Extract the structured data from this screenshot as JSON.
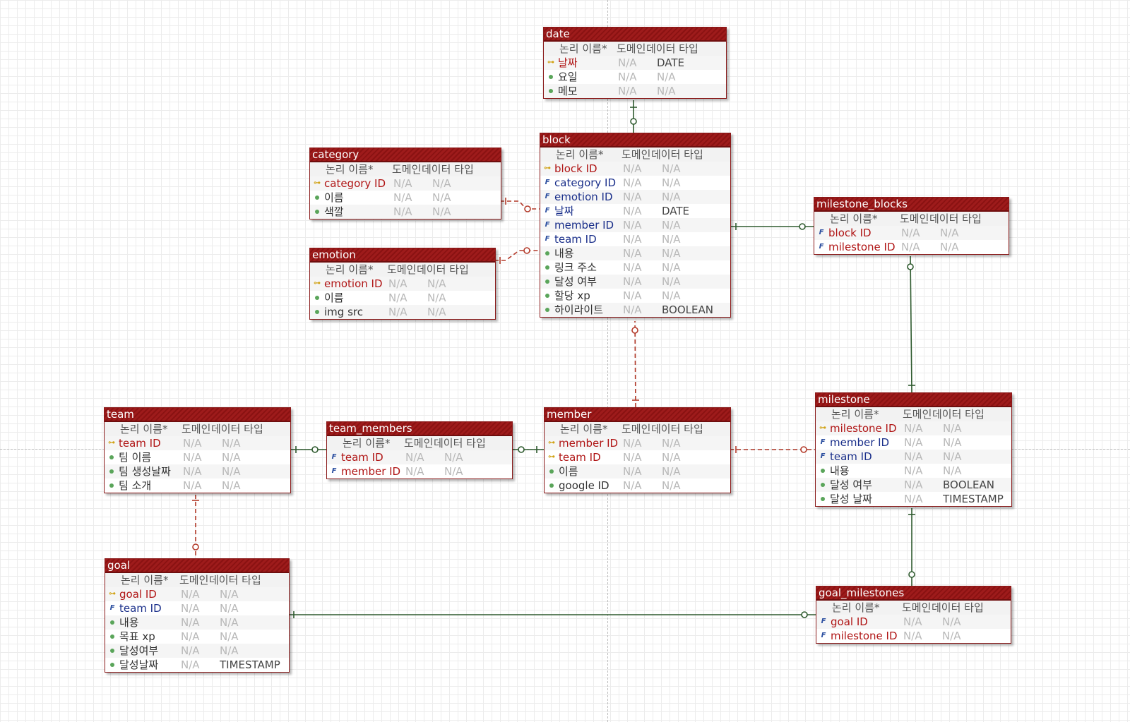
{
  "header_labels": {
    "logical_name": "논리 이름*",
    "domain": "도메인",
    "data_type": "데이터 타입"
  },
  "entities": {
    "date": {
      "name": "date",
      "columns": [
        {
          "name": "날짜",
          "key": "pk",
          "domain": "N/A",
          "type": "DATE"
        },
        {
          "name": "요일",
          "key": "attr",
          "domain": "N/A",
          "type": "N/A"
        },
        {
          "name": "메모",
          "key": "attr",
          "domain": "N/A",
          "type": "N/A"
        }
      ]
    },
    "category": {
      "name": "category",
      "columns": [
        {
          "name": "category ID",
          "key": "pk",
          "domain": "N/A",
          "type": "N/A"
        },
        {
          "name": "이름",
          "key": "attr",
          "domain": "N/A",
          "type": "N/A"
        },
        {
          "name": "색깔",
          "key": "attr",
          "domain": "N/A",
          "type": "N/A"
        }
      ]
    },
    "emotion": {
      "name": "emotion",
      "columns": [
        {
          "name": "emotion ID",
          "key": "pk",
          "domain": "N/A",
          "type": "N/A"
        },
        {
          "name": "이름",
          "key": "attr",
          "domain": "N/A",
          "type": "N/A"
        },
        {
          "name": "img src",
          "key": "attr",
          "domain": "N/A",
          "type": "N/A"
        }
      ]
    },
    "block": {
      "name": "block",
      "columns": [
        {
          "name": "block ID",
          "key": "pk",
          "domain": "N/A",
          "type": "N/A"
        },
        {
          "name": "category ID",
          "key": "fk",
          "domain": "N/A",
          "type": "N/A"
        },
        {
          "name": "emotion ID",
          "key": "fk",
          "domain": "N/A",
          "type": "N/A"
        },
        {
          "name": "날짜",
          "key": "fk",
          "domain": "N/A",
          "type": "DATE"
        },
        {
          "name": "member ID",
          "key": "fk",
          "domain": "N/A",
          "type": "N/A"
        },
        {
          "name": "team ID",
          "key": "fk",
          "domain": "N/A",
          "type": "N/A"
        },
        {
          "name": "내용",
          "key": "attr",
          "domain": "N/A",
          "type": "N/A"
        },
        {
          "name": "링크 주소",
          "key": "attr",
          "domain": "N/A",
          "type": "N/A"
        },
        {
          "name": "달성 여부",
          "key": "attr",
          "domain": "N/A",
          "type": "N/A"
        },
        {
          "name": "할당 xp",
          "key": "attr",
          "domain": "N/A",
          "type": "N/A"
        },
        {
          "name": "하이라이트",
          "key": "attr",
          "domain": "N/A",
          "type": "BOOLEAN"
        }
      ]
    },
    "milestone_blocks": {
      "name": "milestone_blocks",
      "columns": [
        {
          "name": "block ID",
          "key": "pfk",
          "domain": "N/A",
          "type": "N/A"
        },
        {
          "name": "milestone ID",
          "key": "pfk",
          "domain": "N/A",
          "type": "N/A"
        }
      ]
    },
    "team": {
      "name": "team",
      "columns": [
        {
          "name": "team ID",
          "key": "pk",
          "domain": "N/A",
          "type": "N/A"
        },
        {
          "name": "팀 이름",
          "key": "attr",
          "domain": "N/A",
          "type": "N/A"
        },
        {
          "name": "팀 생성날짜",
          "key": "attr",
          "domain": "N/A",
          "type": "N/A"
        },
        {
          "name": "팀 소개",
          "key": "attr",
          "domain": "N/A",
          "type": "N/A"
        }
      ]
    },
    "team_members": {
      "name": "team_members",
      "columns": [
        {
          "name": "team ID",
          "key": "pfk",
          "domain": "N/A",
          "type": "N/A"
        },
        {
          "name": "member ID",
          "key": "pfk",
          "domain": "N/A",
          "type": "N/A"
        }
      ]
    },
    "member": {
      "name": "member",
      "columns": [
        {
          "name": "member ID",
          "key": "pk",
          "domain": "N/A",
          "type": "N/A"
        },
        {
          "name": "team ID",
          "key": "pk",
          "domain": "N/A",
          "type": "N/A"
        },
        {
          "name": "이름",
          "key": "attr",
          "domain": "N/A",
          "type": "N/A"
        },
        {
          "name": "google ID",
          "key": "attr",
          "domain": "N/A",
          "type": "N/A"
        }
      ]
    },
    "milestone": {
      "name": "milestone",
      "columns": [
        {
          "name": "milestone ID",
          "key": "pk",
          "domain": "N/A",
          "type": "N/A"
        },
        {
          "name": "member ID",
          "key": "fk",
          "domain": "N/A",
          "type": "N/A"
        },
        {
          "name": "team ID",
          "key": "fk",
          "domain": "N/A",
          "type": "N/A"
        },
        {
          "name": "내용",
          "key": "attr",
          "domain": "N/A",
          "type": "N/A"
        },
        {
          "name": "달성 여부",
          "key": "attr",
          "domain": "N/A",
          "type": "BOOLEAN"
        },
        {
          "name": "달성 날짜",
          "key": "attr",
          "domain": "N/A",
          "type": "TIMESTAMP"
        }
      ]
    },
    "goal": {
      "name": "goal",
      "columns": [
        {
          "name": "goal ID",
          "key": "pk",
          "domain": "N/A",
          "type": "N/A"
        },
        {
          "name": "team ID",
          "key": "fk",
          "domain": "N/A",
          "type": "N/A"
        },
        {
          "name": "내용",
          "key": "attr",
          "domain": "N/A",
          "type": "N/A"
        },
        {
          "name": "목표 xp",
          "key": "attr",
          "domain": "N/A",
          "type": "N/A"
        },
        {
          "name": "달성여부",
          "key": "attr",
          "domain": "N/A",
          "type": "N/A"
        },
        {
          "name": "달성날짜",
          "key": "attr",
          "domain": "N/A",
          "type": "TIMESTAMP"
        }
      ]
    },
    "goal_milestones": {
      "name": "goal_milestones",
      "columns": [
        {
          "name": "goal ID",
          "key": "pfk",
          "domain": "N/A",
          "type": "N/A"
        },
        {
          "name": "milestone ID",
          "key": "pfk",
          "domain": "N/A",
          "type": "N/A"
        }
      ]
    }
  },
  "relationships": [
    {
      "from": "date",
      "to": "block",
      "style": "identifying"
    },
    {
      "from": "category",
      "to": "block",
      "style": "non-identifying"
    },
    {
      "from": "emotion",
      "to": "block",
      "style": "non-identifying"
    },
    {
      "from": "block",
      "to": "milestone_blocks",
      "style": "identifying"
    },
    {
      "from": "milestone",
      "to": "milestone_blocks",
      "style": "identifying"
    },
    {
      "from": "member",
      "to": "block",
      "style": "non-identifying"
    },
    {
      "from": "team",
      "to": "team_members",
      "style": "identifying"
    },
    {
      "from": "member",
      "to": "team_members",
      "style": "identifying"
    },
    {
      "from": "member",
      "to": "milestone",
      "style": "non-identifying"
    },
    {
      "from": "team",
      "to": "goal",
      "style": "non-identifying"
    },
    {
      "from": "milestone",
      "to": "goal_milestones",
      "style": "identifying"
    },
    {
      "from": "goal",
      "to": "goal_milestones",
      "style": "identifying"
    }
  ],
  "colors": {
    "title_bg": "#9e1b1b",
    "identifying": "#2e5a2e",
    "non_identifying": "#b33a2a"
  }
}
